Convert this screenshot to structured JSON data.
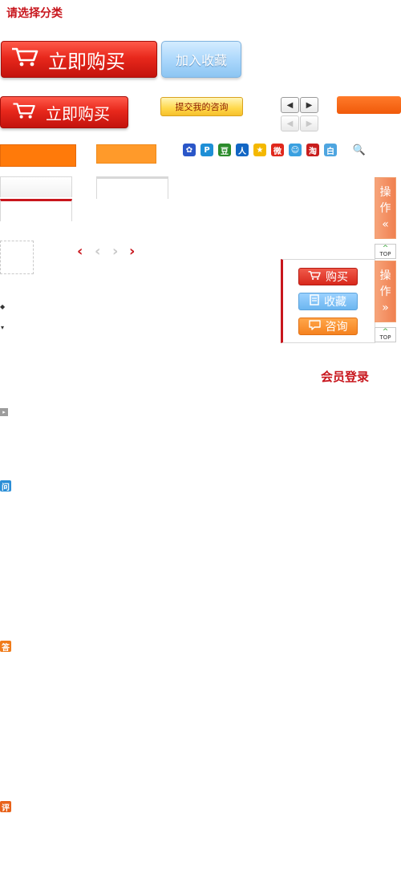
{
  "title": "请选择分类",
  "buy_button_large": {
    "label": "立即购买"
  },
  "favorite_button_large": {
    "label": "加入收藏"
  },
  "buy_button_medium": {
    "label": "立即购买"
  },
  "submit_consult_button": {
    "label": "提交我的咨询"
  },
  "pager_arrows": {
    "prev": "◀",
    "next": "▶"
  },
  "share_icons": [
    {
      "name": "baidu-icon",
      "glyph": "✿",
      "color": "#2a56c8"
    },
    {
      "name": "qzone-icon",
      "glyph": "P",
      "color": "#1e8fd6"
    },
    {
      "name": "douban-icon",
      "glyph": "豆",
      "color": "#2c8c2c"
    },
    {
      "name": "renren-icon",
      "glyph": "人",
      "color": "#1266c4"
    },
    {
      "name": "favorite-star-icon",
      "glyph": "★",
      "color": "#f4b800"
    },
    {
      "name": "weibo-icon",
      "glyph": "微",
      "color": "#e0281c"
    },
    {
      "name": "tencent-weibo-icon",
      "glyph": "☺",
      "color": "#3aa0e0"
    },
    {
      "name": "taobao-icon",
      "glyph": "淘",
      "color": "#c81e1e"
    },
    {
      "name": "baidu-bai-icon",
      "glyph": "白",
      "color": "#4ea5e0"
    },
    {
      "name": "search-icon",
      "glyph": "🔍",
      "color": "#ffffff"
    }
  ],
  "chevrons": [
    {
      "name": "prev-active",
      "glyph": "‹",
      "color": "#c8161d"
    },
    {
      "name": "prev-inactive",
      "glyph": "‹",
      "color": "#c9c9c9"
    },
    {
      "name": "next-inactive",
      "glyph": "›",
      "color": "#c9c9c9"
    },
    {
      "name": "next-active",
      "glyph": "›",
      "color": "#c8161d"
    }
  ],
  "side_tabs": [
    {
      "char1": "操",
      "char2": "作",
      "arrow": "«"
    },
    {
      "char1": "操",
      "char2": "作",
      "arrow": "»"
    }
  ],
  "top_button": {
    "label": "TOP",
    "arrow": "^"
  },
  "panel": {
    "buy": "购买",
    "favorite": "收藏",
    "consult": "咨询"
  },
  "member_login": "会员登录",
  "markers": {
    "diamond": "◆",
    "v": "▾",
    "gray_arrow": "▸"
  },
  "qa_labels": {
    "ask": "问",
    "answer": "答",
    "review": "评"
  },
  "colors": {
    "brand_red": "#c8161d",
    "orange": "#ff7a0a",
    "blue": "#6cb6f0"
  }
}
